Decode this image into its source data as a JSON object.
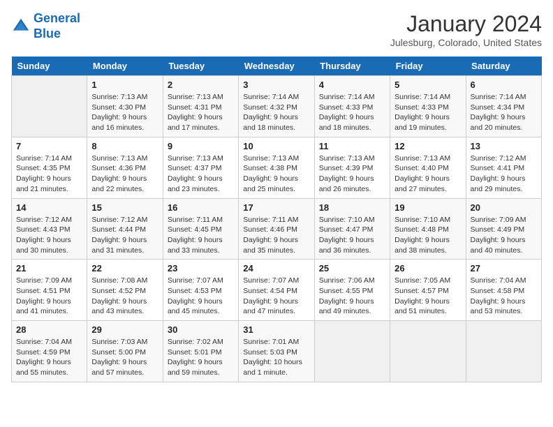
{
  "logo": {
    "line1": "General",
    "line2": "Blue"
  },
  "title": "January 2024",
  "subtitle": "Julesburg, Colorado, United States",
  "days_of_week": [
    "Sunday",
    "Monday",
    "Tuesday",
    "Wednesday",
    "Thursday",
    "Friday",
    "Saturday"
  ],
  "weeks": [
    [
      {
        "day": "",
        "info": ""
      },
      {
        "day": "1",
        "info": "Sunrise: 7:13 AM\nSunset: 4:30 PM\nDaylight: 9 hours\nand 16 minutes."
      },
      {
        "day": "2",
        "info": "Sunrise: 7:13 AM\nSunset: 4:31 PM\nDaylight: 9 hours\nand 17 minutes."
      },
      {
        "day": "3",
        "info": "Sunrise: 7:14 AM\nSunset: 4:32 PM\nDaylight: 9 hours\nand 18 minutes."
      },
      {
        "day": "4",
        "info": "Sunrise: 7:14 AM\nSunset: 4:33 PM\nDaylight: 9 hours\nand 18 minutes."
      },
      {
        "day": "5",
        "info": "Sunrise: 7:14 AM\nSunset: 4:33 PM\nDaylight: 9 hours\nand 19 minutes."
      },
      {
        "day": "6",
        "info": "Sunrise: 7:14 AM\nSunset: 4:34 PM\nDaylight: 9 hours\nand 20 minutes."
      }
    ],
    [
      {
        "day": "7",
        "info": "Sunrise: 7:14 AM\nSunset: 4:35 PM\nDaylight: 9 hours\nand 21 minutes."
      },
      {
        "day": "8",
        "info": "Sunrise: 7:13 AM\nSunset: 4:36 PM\nDaylight: 9 hours\nand 22 minutes."
      },
      {
        "day": "9",
        "info": "Sunrise: 7:13 AM\nSunset: 4:37 PM\nDaylight: 9 hours\nand 23 minutes."
      },
      {
        "day": "10",
        "info": "Sunrise: 7:13 AM\nSunset: 4:38 PM\nDaylight: 9 hours\nand 25 minutes."
      },
      {
        "day": "11",
        "info": "Sunrise: 7:13 AM\nSunset: 4:39 PM\nDaylight: 9 hours\nand 26 minutes."
      },
      {
        "day": "12",
        "info": "Sunrise: 7:13 AM\nSunset: 4:40 PM\nDaylight: 9 hours\nand 27 minutes."
      },
      {
        "day": "13",
        "info": "Sunrise: 7:12 AM\nSunset: 4:41 PM\nDaylight: 9 hours\nand 29 minutes."
      }
    ],
    [
      {
        "day": "14",
        "info": "Sunrise: 7:12 AM\nSunset: 4:43 PM\nDaylight: 9 hours\nand 30 minutes."
      },
      {
        "day": "15",
        "info": "Sunrise: 7:12 AM\nSunset: 4:44 PM\nDaylight: 9 hours\nand 31 minutes."
      },
      {
        "day": "16",
        "info": "Sunrise: 7:11 AM\nSunset: 4:45 PM\nDaylight: 9 hours\nand 33 minutes."
      },
      {
        "day": "17",
        "info": "Sunrise: 7:11 AM\nSunset: 4:46 PM\nDaylight: 9 hours\nand 35 minutes."
      },
      {
        "day": "18",
        "info": "Sunrise: 7:10 AM\nSunset: 4:47 PM\nDaylight: 9 hours\nand 36 minutes."
      },
      {
        "day": "19",
        "info": "Sunrise: 7:10 AM\nSunset: 4:48 PM\nDaylight: 9 hours\nand 38 minutes."
      },
      {
        "day": "20",
        "info": "Sunrise: 7:09 AM\nSunset: 4:49 PM\nDaylight: 9 hours\nand 40 minutes."
      }
    ],
    [
      {
        "day": "21",
        "info": "Sunrise: 7:09 AM\nSunset: 4:51 PM\nDaylight: 9 hours\nand 41 minutes."
      },
      {
        "day": "22",
        "info": "Sunrise: 7:08 AM\nSunset: 4:52 PM\nDaylight: 9 hours\nand 43 minutes."
      },
      {
        "day": "23",
        "info": "Sunrise: 7:07 AM\nSunset: 4:53 PM\nDaylight: 9 hours\nand 45 minutes."
      },
      {
        "day": "24",
        "info": "Sunrise: 7:07 AM\nSunset: 4:54 PM\nDaylight: 9 hours\nand 47 minutes."
      },
      {
        "day": "25",
        "info": "Sunrise: 7:06 AM\nSunset: 4:55 PM\nDaylight: 9 hours\nand 49 minutes."
      },
      {
        "day": "26",
        "info": "Sunrise: 7:05 AM\nSunset: 4:57 PM\nDaylight: 9 hours\nand 51 minutes."
      },
      {
        "day": "27",
        "info": "Sunrise: 7:04 AM\nSunset: 4:58 PM\nDaylight: 9 hours\nand 53 minutes."
      }
    ],
    [
      {
        "day": "28",
        "info": "Sunrise: 7:04 AM\nSunset: 4:59 PM\nDaylight: 9 hours\nand 55 minutes."
      },
      {
        "day": "29",
        "info": "Sunrise: 7:03 AM\nSunset: 5:00 PM\nDaylight: 9 hours\nand 57 minutes."
      },
      {
        "day": "30",
        "info": "Sunrise: 7:02 AM\nSunset: 5:01 PM\nDaylight: 9 hours\nand 59 minutes."
      },
      {
        "day": "31",
        "info": "Sunrise: 7:01 AM\nSunset: 5:03 PM\nDaylight: 10 hours\nand 1 minute."
      },
      {
        "day": "",
        "info": ""
      },
      {
        "day": "",
        "info": ""
      },
      {
        "day": "",
        "info": ""
      }
    ]
  ]
}
